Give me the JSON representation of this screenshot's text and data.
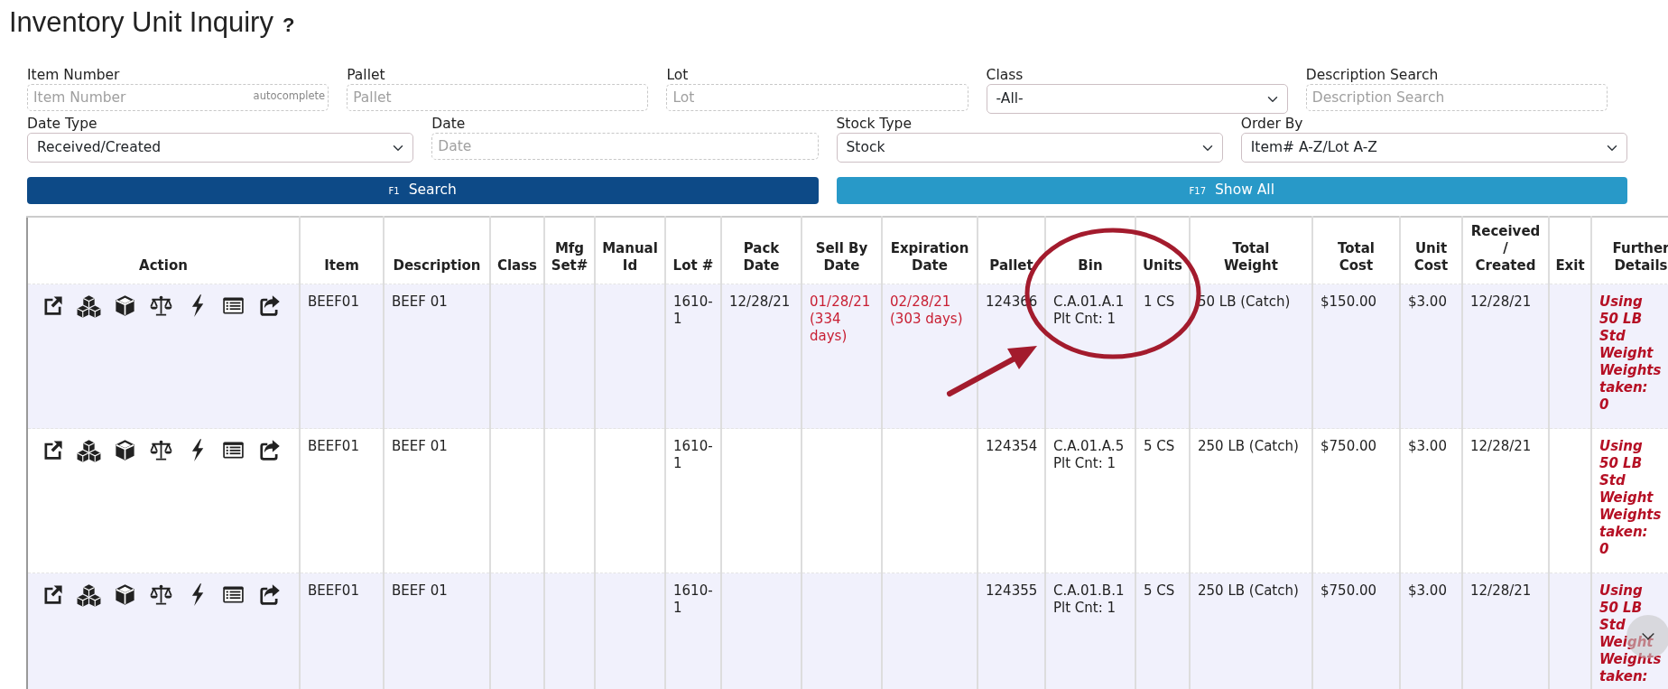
{
  "title": "Inventory Unit Inquiry",
  "help": "?",
  "filter_rows": [
    [
      {
        "label": "Item Number",
        "kind": "text",
        "placeholder": "Item Number",
        "hint": "autocomplete"
      },
      {
        "label": "Pallet",
        "kind": "text",
        "placeholder": "Pallet"
      },
      {
        "label": "Lot",
        "kind": "text",
        "placeholder": "Lot"
      },
      {
        "label": "Class",
        "kind": "select",
        "value": "-All-"
      },
      {
        "label": "Description Search",
        "kind": "text",
        "placeholder": "Description Search"
      }
    ],
    [
      {
        "label": "Date Type",
        "kind": "select",
        "value": "Received/Created"
      },
      {
        "label": "Date",
        "kind": "text",
        "placeholder": "Date"
      },
      {
        "label": "Stock Type",
        "kind": "select",
        "value": "Stock"
      },
      {
        "label": "Order By",
        "kind": "select",
        "value": "Item# A-Z/Lot A-Z"
      }
    ]
  ],
  "buttons": [
    {
      "key": "F1",
      "label": "Search",
      "kind": "primary"
    },
    {
      "key": "F17",
      "label": "Show All",
      "kind": "secondary"
    }
  ],
  "table": {
    "columns": [
      {
        "label": "Action",
        "kind": "actions"
      },
      {
        "label": "Item",
        "kind": "plain"
      },
      {
        "label": "Description",
        "kind": "plain"
      },
      {
        "label": "Class",
        "kind": "plain"
      },
      {
        "label": "Mfg\nSet#",
        "kind": "plain"
      },
      {
        "label": "Manual\nId",
        "kind": "plain"
      },
      {
        "label": "Lot #",
        "kind": "plain"
      },
      {
        "label": "Pack\nDate",
        "kind": "plain"
      },
      {
        "label": "Sell By\nDate",
        "kind": "warning"
      },
      {
        "label": "Expiration\nDate",
        "kind": "warning"
      },
      {
        "label": "Pallet",
        "kind": "plain"
      },
      {
        "label": "Bin",
        "kind": "plain"
      },
      {
        "label": "Units",
        "kind": "plain"
      },
      {
        "label": "Total\nWeight",
        "kind": "plain"
      },
      {
        "label": "Total\nCost",
        "kind": "plain"
      },
      {
        "label": "Unit\nCost",
        "kind": "plain"
      },
      {
        "label": "Received\n/\nCreated",
        "kind": "plain"
      },
      {
        "label": "Exit",
        "kind": "plain"
      },
      {
        "label": "Further\nDetails",
        "kind": "note"
      }
    ],
    "rows": [
      {
        "cells": [
          null,
          "BEEF01",
          "BEEF 01",
          null,
          null,
          null,
          "1610-1",
          "12/28/21",
          "01/28/21 (334 days)",
          "02/28/21 (303 days)",
          "124366",
          "C.A.01.A.1\nPlt Cnt: 1",
          "1 CS",
          "50 LB (Catch)",
          "$150.00",
          "$3.00",
          "12/28/21",
          null,
          "Using\n50 LB\nStd\nWeight\nWeights\ntaken:\n0"
        ]
      },
      {
        "cells": [
          null,
          "BEEF01",
          "BEEF 01",
          null,
          null,
          null,
          "1610-1",
          null,
          null,
          null,
          "124354",
          "C.A.01.A.5\nPlt Cnt: 1",
          "5 CS",
          "250 LB (Catch)",
          "$750.00",
          "$3.00",
          "12/28/21",
          null,
          "Using\n50 LB\nStd\nWeight\nWeights\ntaken:\n0"
        ]
      },
      {
        "cells": [
          null,
          "BEEF01",
          "BEEF 01",
          null,
          null,
          null,
          "1610-1",
          null,
          null,
          null,
          "124355",
          "C.A.01.B.1\nPlt Cnt: 1",
          "5 CS",
          "250 LB (Catch)",
          "$750.00",
          "$3.00",
          "12/28/21",
          null,
          "Using\n50 LB\nStd\nWeight\nWeights\ntaken:"
        ]
      }
    ]
  }
}
